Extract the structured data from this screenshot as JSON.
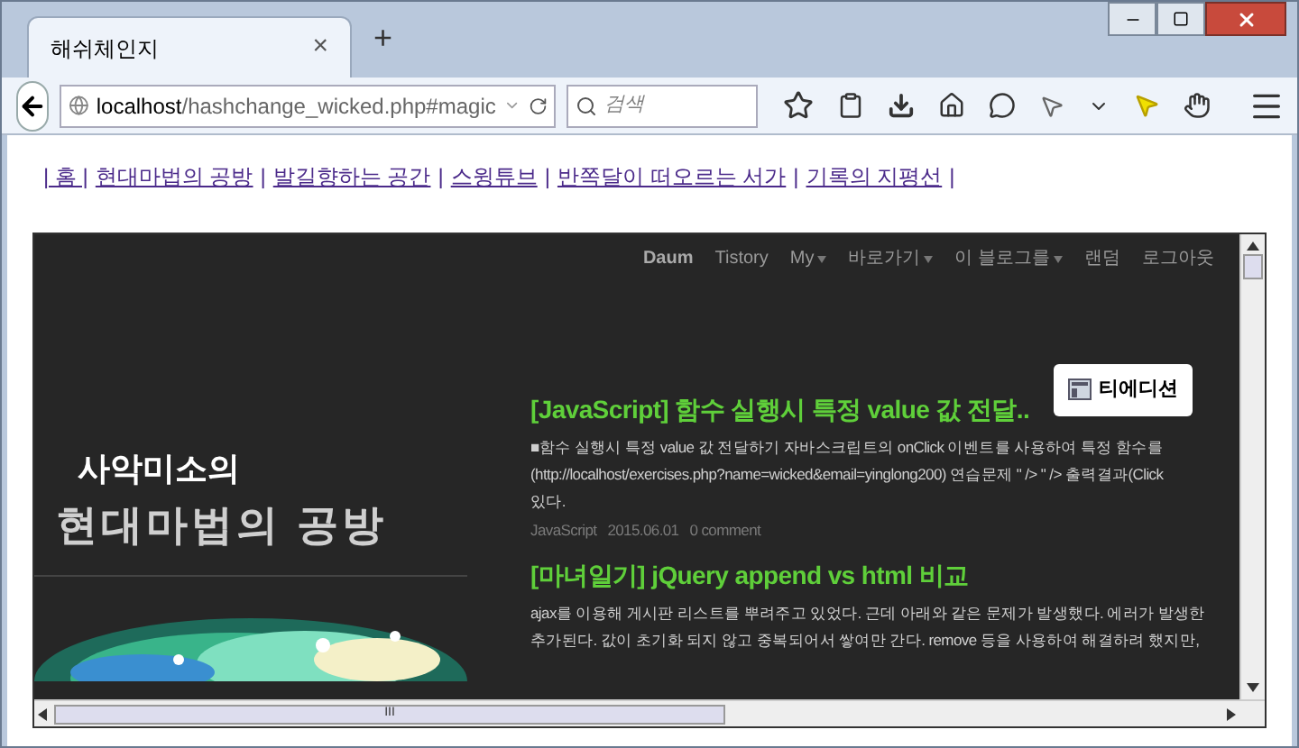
{
  "tab": {
    "title": "해쉬체인지",
    "close": "×",
    "new_tab": "+"
  },
  "address_bar": {
    "host": "localhost",
    "path": "/hashchange_wicked.php#magic"
  },
  "search": {
    "placeholder": "검색"
  },
  "links": [
    "| 홈 |",
    "현대마법의 공방",
    "|",
    "발길향하는 공간",
    "|",
    "스윙튜브",
    "|",
    "반쪽달이 떠오르는 서가",
    "|",
    "기록의 지평선",
    "|"
  ],
  "blog": {
    "menu": [
      {
        "label": "Daum",
        "bold": true,
        "dropdown": false
      },
      {
        "label": "Tistory",
        "bold": false,
        "dropdown": false
      },
      {
        "label": "My",
        "bold": false,
        "dropdown": true
      },
      {
        "label": "바로가기",
        "bold": false,
        "dropdown": true
      },
      {
        "label": "이 블로그를",
        "bold": false,
        "dropdown": true
      },
      {
        "label": "랜덤",
        "bold": false,
        "dropdown": false
      },
      {
        "label": "로그아웃",
        "bold": false,
        "dropdown": false
      }
    ],
    "edition_button": "티에디션",
    "title_small": "사악미소의",
    "title_large": "현대마법의 공방",
    "posts": [
      {
        "title": "[JavaScript] 함수 실행시 특정 value 값 전달..",
        "lines": [
          "■함수 실행시 특정 value 값 전달하기 자바스크립트의 onClick 이벤트를 사용하여 특정 함수를",
          "(http://localhost/exercises.php?name=wicked&email=yinglong200) 연습문제 \" /> \" /> 출력결과(Click",
          "있다."
        ],
        "meta": [
          "JavaScript",
          "2015.06.01",
          "0 comment"
        ]
      },
      {
        "title": "[마녀일기] jQuery append vs html 비교",
        "lines": [
          "ajax를 이용해 게시판 리스트를 뿌려주고 있었다. 근데 아래와 같은 문제가 발생했다. 에러가 발생한",
          "추가된다. 값이 초기화 되지 않고 중복되어서 쌓여만 간다. remove 등을 사용하여 해결하려 했지만,"
        ]
      }
    ]
  },
  "hscroll": {
    "grip": "III"
  }
}
